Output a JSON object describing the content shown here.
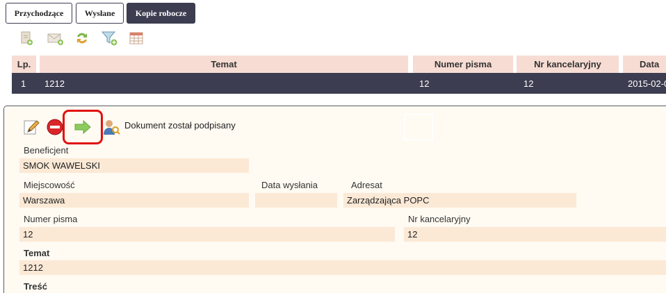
{
  "tabs": [
    {
      "label": "Przychodzące",
      "active": false
    },
    {
      "label": "Wysłane",
      "active": false
    },
    {
      "label": "Kopie robocze",
      "active": true
    }
  ],
  "toolbar_icons": [
    "new-document-icon",
    "send-mail-icon",
    "refresh-icon",
    "filter-add-icon",
    "table-columns-icon"
  ],
  "table": {
    "columns": [
      "Lp.",
      "Temat",
      "Numer pisma",
      "Nr kancelaryjny",
      "Data"
    ],
    "rows": [
      [
        "1",
        "1212",
        "12",
        "12",
        "2015-02-0"
      ]
    ]
  },
  "detail": {
    "status_text": "Dokument został podpisany",
    "fields": {
      "beneficjent_label": "Beneficjent",
      "beneficjent_value": "SMOK WAWELSKI",
      "miejscowosc_label": "Miejscowość",
      "miejscowosc_value": "Warszawa",
      "data_wyslania_label": "Data wysłania",
      "data_wyslania_value": "",
      "adresat_label": "Adresat",
      "adresat_value": "Zarządzająca POPC",
      "numer_pisma_label": "Numer pisma",
      "numer_pisma_value": "12",
      "nr_kancelaryjny_label": "Nr kancelaryjny",
      "nr_kancelaryjny_value": "12",
      "temat_label": "Temat",
      "temat_value": "1212",
      "tresc_label": "Treść"
    }
  },
  "colors": {
    "dark": "#3c3d50",
    "header_bg": "#f7dcd4",
    "field_bg": "#fbe9d6",
    "highlight": "#e01010"
  }
}
